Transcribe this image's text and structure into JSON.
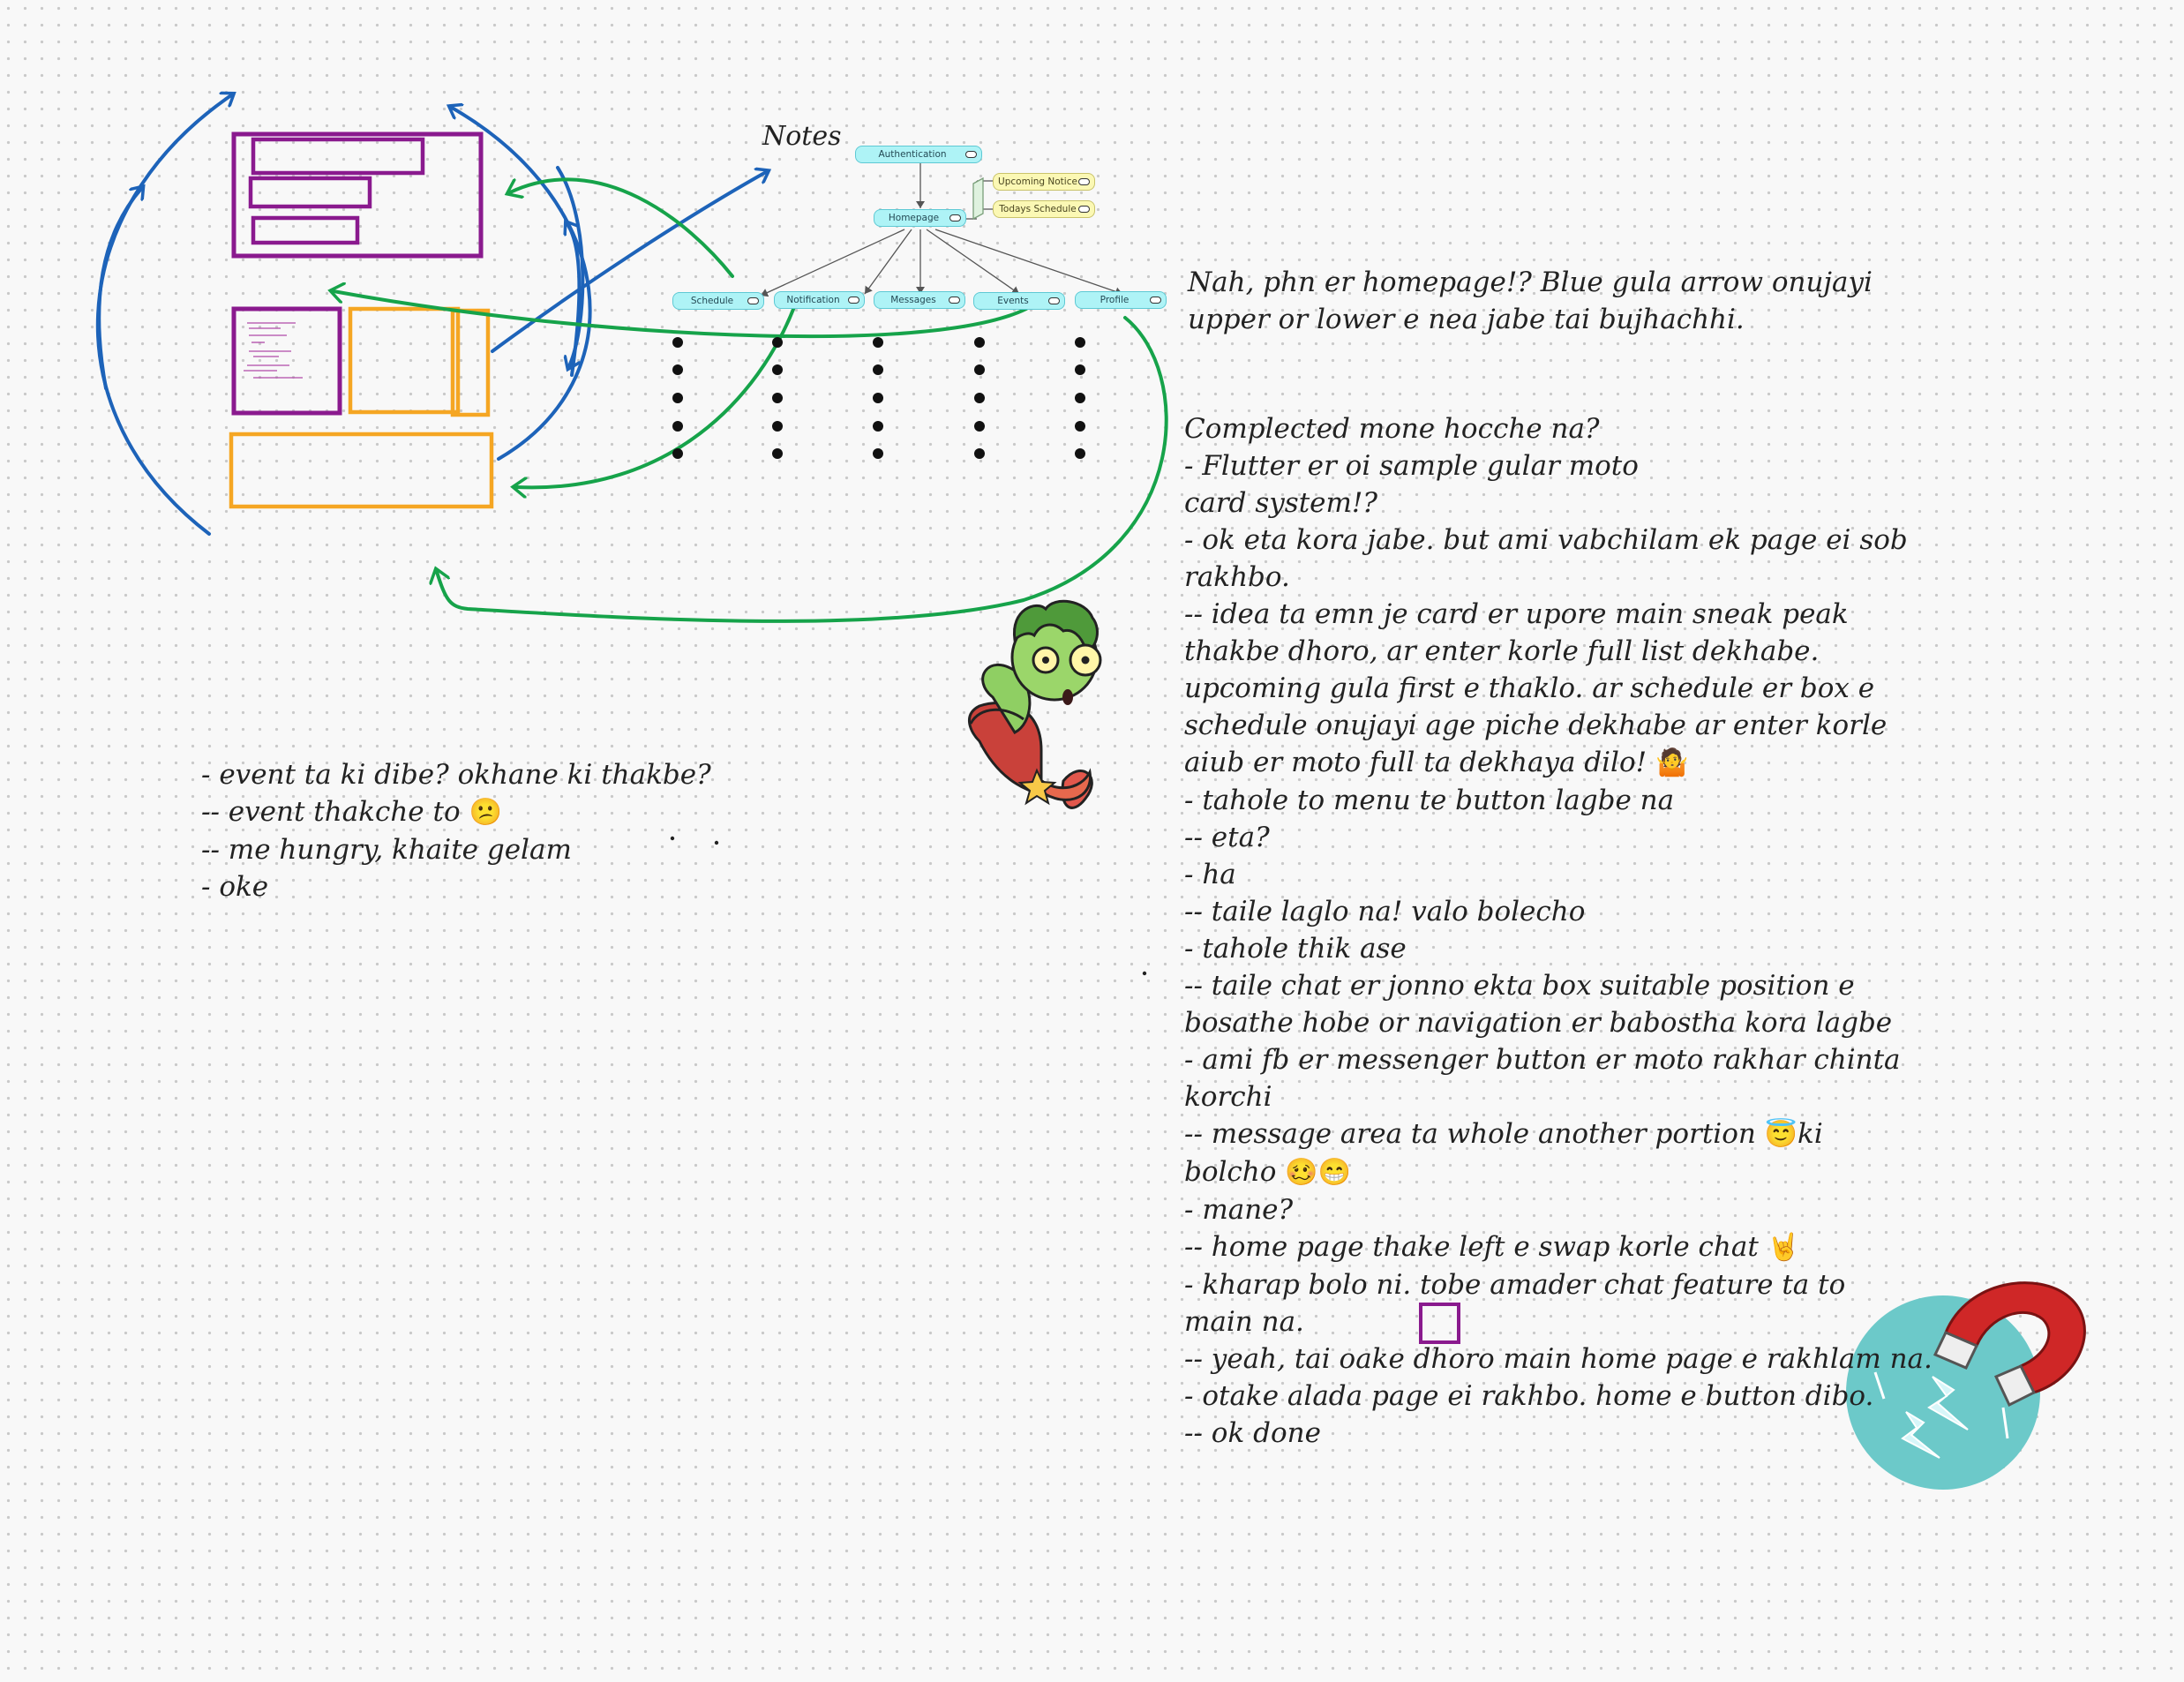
{
  "heading": "Notes",
  "diagram": {
    "root": "Authentication",
    "homepage": "Homepage",
    "side_notes": [
      "Upcoming Notice",
      "Todays  Schedule"
    ],
    "children": [
      "Schedule",
      "Notification",
      "Messages",
      "Events",
      "Profile"
    ]
  },
  "notes": {
    "block1": [
      "Nah, phn er homepage!? Blue gula arrow onujayi",
      "upper or lower e nea jabe tai bujhachhi."
    ],
    "block2": [
      "Complected mone hocche na?",
      "- Flutter er oi sample gular moto",
      "card system!?",
      "",
      "- ok eta kora jabe. but ami vabchilam ek page ei sob",
      "rakhbo.",
      "",
      "-- idea ta emn je card er upore main sneak peak",
      "thakbe dhoro, ar enter korle full list dekhabe.",
      "upcoming gula first e thaklo. ar schedule er box e",
      "schedule onujayi age piche dekhabe ar enter korle",
      "aiub er moto full ta dekhaya dilo!",
      "",
      "- tahole to menu te button lagbe na",
      "-- eta?",
      "- ha",
      "-- taile laglo na! valo bolecho",
      "- tahole thik ase",
      "-- taile chat er jonno ekta box suitable position e",
      "bosathe hobe or navigation er babostha kora lagbe",
      "- ami fb er messenger button er moto rakhar chinta",
      "korchi",
      "-- message area ta whole another portion",
      "ki",
      "bolcho",
      "- mane?",
      "-- home page thake left e swap korle chat",
      "- kharap bolo ni. tobe amader chat feature ta to",
      "main na.",
      "-- yeah, tai oake dhoro main home page e rakhlam na.",
      "- otake alada page ei rakhbo. home e button dibo.",
      "-- ok done"
    ],
    "block3": [
      "- event ta ki dibe? okhane ki thakbe?",
      "-- event thakche to",
      "-- me hungry, khaite gelam",
      "- oke"
    ]
  },
  "emojis": {
    "shrug": "🤷",
    "confused": "😕",
    "angel": "😇",
    "woozy": "🥴",
    "grin": "😁",
    "rock": "🤘"
  },
  "colors": {
    "purple": "#8a1a8e",
    "orange": "#f5a623",
    "blue": "#1d63b9",
    "green": "#16a34a",
    "node_fill": "#aef3f6",
    "note_fill": "#fbf8b4",
    "magnet_circle": "#6cc9c9",
    "magnet_red": "#cf2727"
  }
}
